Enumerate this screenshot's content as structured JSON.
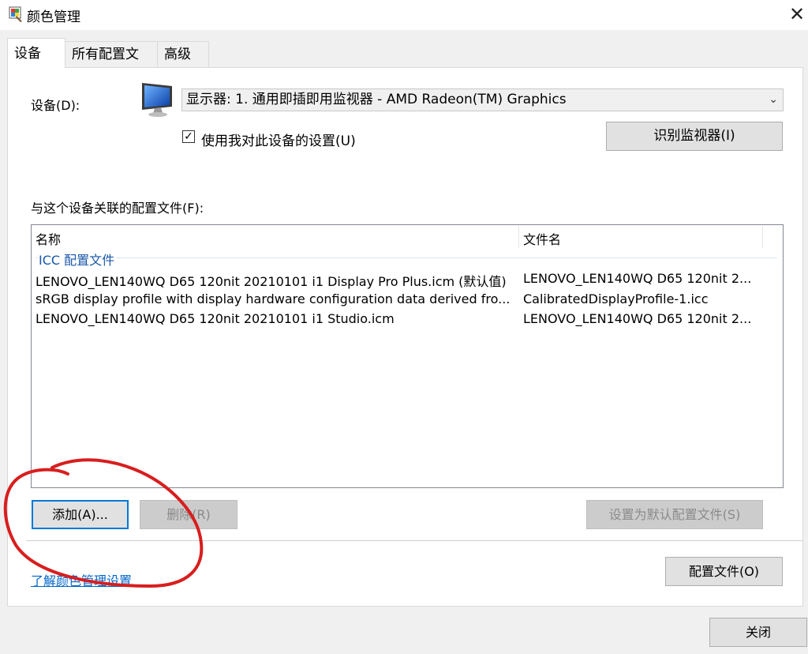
{
  "window": {
    "title": "颜色管理",
    "close_glyph": "✕"
  },
  "tabs": [
    {
      "label": "设备",
      "active": true
    },
    {
      "label": "所有配置文件",
      "active": false
    },
    {
      "label": "高级",
      "active": false
    }
  ],
  "device": {
    "label": "设备(D):",
    "selected": "显示器: 1. 通用即插即用监视器 - AMD Radeon(TM) Graphics",
    "use_settings_label": "使用我对此设备的设置(U)",
    "use_settings_checked": true,
    "identify_button": "识别监视器(I)",
    "icon": "monitor-icon"
  },
  "profiles": {
    "label": "与这个设备关联的配置文件(F):",
    "columns": [
      "名称",
      "文件名"
    ],
    "group": "ICC 配置文件",
    "rows": [
      {
        "name": "LENOVO_LEN140WQ D65 120nit 20210101 i1 Display Pro Plus.icm (默认值)",
        "file": "LENOVO_LEN140WQ D65 120nit 2..."
      },
      {
        "name": "sRGB display profile with display hardware configuration data derived fro...",
        "file": "CalibratedDisplayProfile-1.icc"
      },
      {
        "name": "LENOVO_LEN140WQ D65 120nit 20210101 i1 Studio.icm",
        "file": "LENOVO_LEN140WQ D65 120nit 2..."
      }
    ]
  },
  "buttons": {
    "add": "添加(A)...",
    "remove": "删除(R)",
    "set_default": "设置为默认配置文件(S)",
    "profiles": "配置文件(O)",
    "close": "关闭"
  },
  "link": "了解颜色管理设置",
  "colors": {
    "accent": "#0078d7",
    "link": "#0066cc",
    "group_label": "#1a57a8",
    "annotation": "#d81e1e"
  }
}
